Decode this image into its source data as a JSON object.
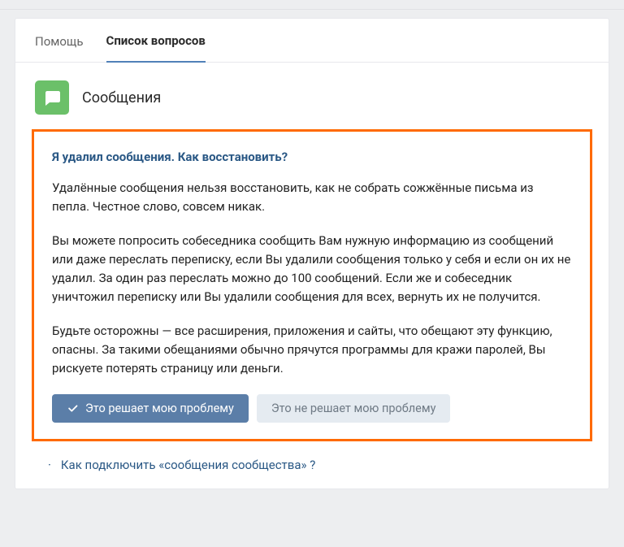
{
  "tabs": {
    "help": "Помощь",
    "questions": "Список вопросов"
  },
  "section": {
    "title": "Сообщения"
  },
  "question": {
    "title": "Я удалил сообщения. Как восстановить?",
    "p1": "Удалённые сообщения нельзя восстановить, как не собрать сожжённые письма из пепла. Честное слово, совсем никак.",
    "p2": "Вы можете попросить собеседника сообщить Вам нужную информацию из сообщений или даже переслать переписку, если Вы удалили сообщения только у себя и если он их не удалил. За один раз переслать можно до 100 сообщений. Если же и собеседник уничтожил переписку или Вы удалили сообщения для всех, вернуть их не получится.",
    "p3": "Будьте осторожны — все расширения, приложения и сайты, что обещают эту функцию, опасны. За такими обещаниями обычно прячутся программы для кражи паролей, Вы рискуете потерять страницу или деньги."
  },
  "buttons": {
    "solves": "Это решает мою проблему",
    "not_solves": "Это не решает мою проблему"
  },
  "related": {
    "q1": "Как подключить «сообщения сообщества» ?"
  }
}
